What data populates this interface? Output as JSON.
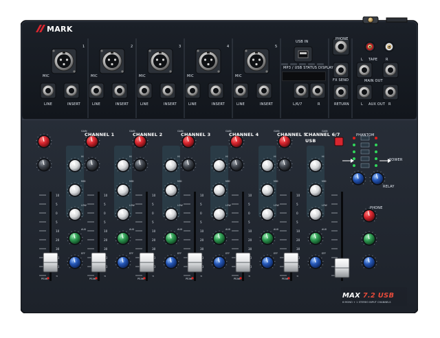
{
  "product": {
    "brand": "MARK",
    "model": {
      "prefix": "MAX",
      "number": "7.2",
      "suffix": "USB"
    },
    "model_subline": "6 MONO + 1 STEREO INPUT CHANNELS"
  },
  "rear_labels": {
    "channel_numbers": [
      "1",
      "2",
      "3",
      "4",
      "5"
    ],
    "mic": "MIC",
    "line": "LINE",
    "insert": "INSERT",
    "usb_in": "USB IN",
    "display": "MP3 / USB STATUS DISPLAY",
    "phone": "PHONE",
    "tape": "TAPE",
    "main_out": "MAIN OUT",
    "aux_out": "AUX OUT",
    "fx_send": "FX SEND",
    "return": "RETURN",
    "l": "L",
    "r": "R",
    "l_67": "L/6/7",
    "r_small": "R"
  },
  "channels": [
    {
      "label": "CHANNEL 1"
    },
    {
      "label": "CHANNEL 2"
    },
    {
      "label": "CHANNEL 3"
    },
    {
      "label": "CHANNEL 4"
    },
    {
      "label": "CHANNEL 5"
    },
    {
      "label": "CHANNEL 6/7",
      "sublabel": "USB"
    }
  ],
  "strip_labels": {
    "gain": "GAIN",
    "hi": "HI",
    "mid": "MID",
    "low": "LOW",
    "aux": "AUX",
    "eff": "EFF",
    "pan": "PAN",
    "peak": "PEAK",
    "fader_scale": [
      "10",
      "5",
      "0",
      "5",
      "10",
      "20",
      "30",
      "40",
      "50",
      "∞"
    ]
  },
  "master_labels": {
    "phantom": "PHANTOM",
    "power": "POWER",
    "relay": "RELAY",
    "aux_master": "AUX",
    "eff_master": "EFF",
    "phone_level": "PHONE"
  },
  "colors": {
    "panel": "#232a34",
    "top_panel": "#161a20",
    "gain_knob": "#d9262f",
    "aux_knob": "#2e9a52",
    "eff_knob": "#2456b6",
    "eq_knob": "#d8dadc",
    "eq_bay": "#2b3d48",
    "peak_led": "#e0201c",
    "meter_led": "#31d65b"
  }
}
